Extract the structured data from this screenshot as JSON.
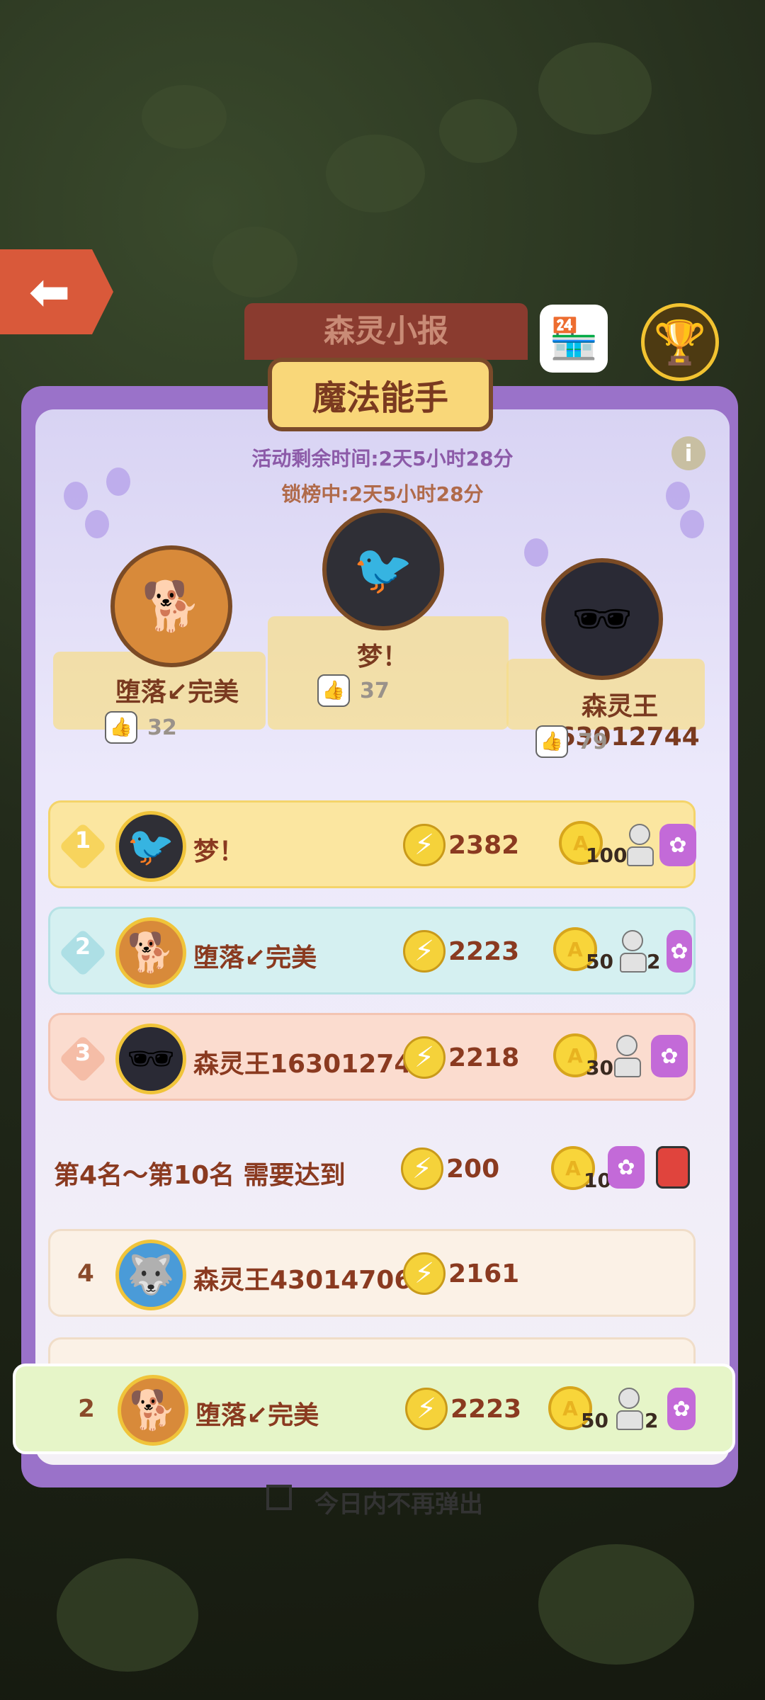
{
  "header": {
    "banner_title": "森灵小报",
    "panel_title": "魔法能手",
    "time_remaining": "活动剩余时间:2天5小时28分",
    "lock_time": "锁榜中:2天5小时28分",
    "info_symbol": "i"
  },
  "podium": [
    {
      "place": 2,
      "name": "堕落↙完美",
      "likes": "32",
      "avatar": "shiba-dog"
    },
    {
      "place": 1,
      "name": "梦！",
      "likes": "37",
      "avatar": "black-bird"
    },
    {
      "place": 3,
      "name": "森灵王163012744",
      "likes": "79",
      "avatar": "sunglasses-bird"
    }
  ],
  "leaderboard": [
    {
      "rank": "1",
      "name": "梦！",
      "score": "2382",
      "coin": "100",
      "pawn": "",
      "color": "#fbe6a0"
    },
    {
      "rank": "2",
      "name": "堕落↙完美",
      "score": "2223",
      "coin": "50",
      "pawn": "2",
      "color": "#d5f0f1"
    },
    {
      "rank": "3",
      "name": "森灵王163012744",
      "score": "2218",
      "coin": "30",
      "pawn": "",
      "color": "#fbdccf"
    },
    {
      "rank": "4",
      "name": "森灵王43014706",
      "score": "2161"
    }
  ],
  "requirement": {
    "text": "第4名～第10名 需要达到",
    "score": "200",
    "coin": "10"
  },
  "my_entry": {
    "rank": "2",
    "name": "堕落↙完美",
    "score": "2223",
    "coin": "50",
    "pawn": "2"
  },
  "footer": {
    "checkbox_label": "今日内不再弹出"
  },
  "colors": {
    "panel_border": "#9a72c9",
    "title_plate": "#f9d779",
    "my_row": "#e6f5c8",
    "coin": "#f8d53a"
  }
}
